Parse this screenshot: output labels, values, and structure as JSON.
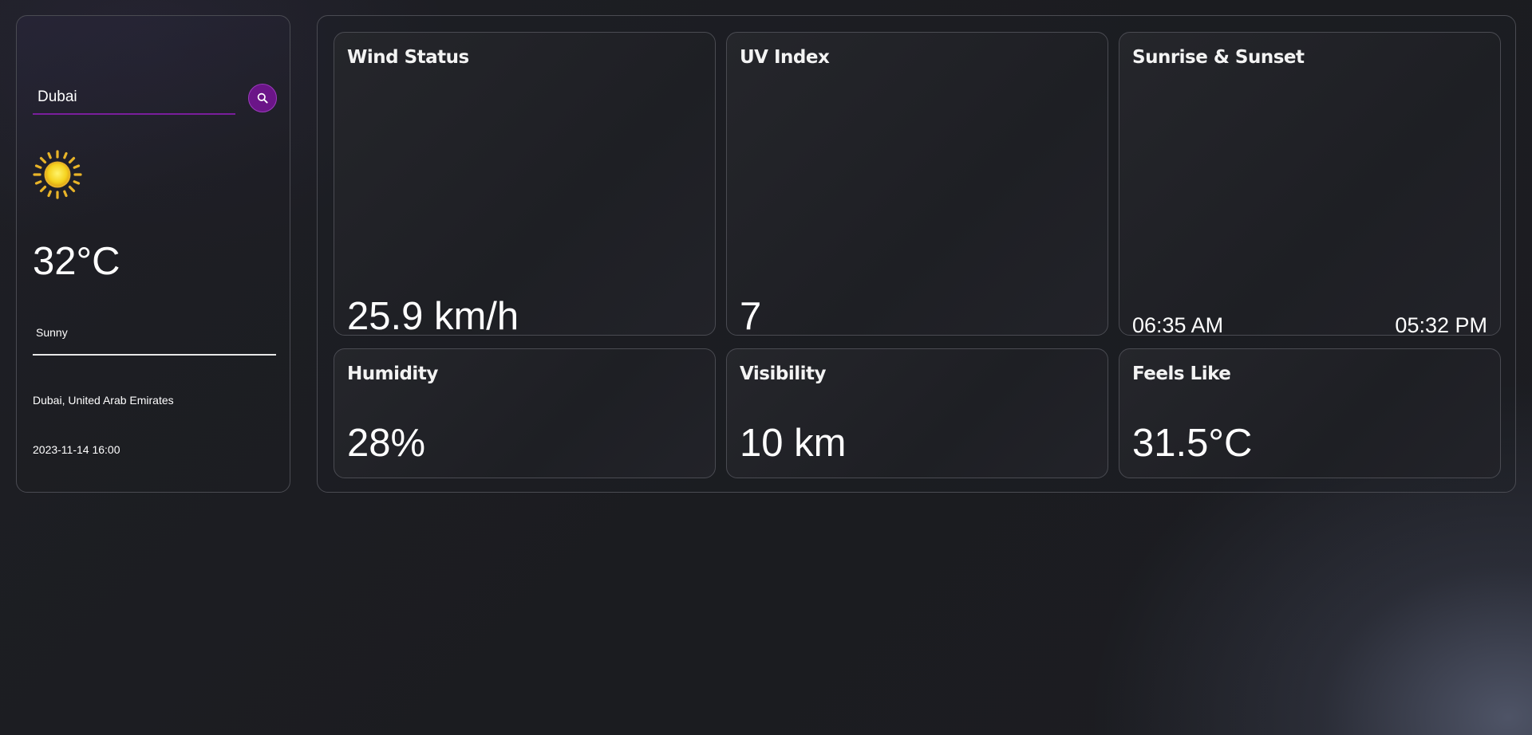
{
  "sidebar": {
    "search": {
      "value": "Dubai",
      "placeholder": ""
    },
    "search_icon": "search-icon",
    "weather_icon": "sun-icon",
    "temperature": "32°C",
    "condition": "Sunny",
    "location": "Dubai, United Arab Emirates",
    "datetime": "2023-11-14 16:00"
  },
  "highlights": {
    "wind": {
      "title": "Wind Status",
      "value": "25.9 km/h"
    },
    "uv": {
      "title": "UV Index",
      "value": "7"
    },
    "sun": {
      "title": "Sunrise & Sunset",
      "sunrise": "06:35 AM",
      "sunset": "05:32 PM"
    },
    "humidity": {
      "title": "Humidity",
      "value": "28%"
    },
    "visibility": {
      "title": "Visibility",
      "value": "10 km"
    },
    "feels_like": {
      "title": "Feels Like",
      "value": "31.5°C"
    }
  },
  "colors": {
    "accent": "#6b1588",
    "search_underline": "#7a1e9c",
    "card_border": "#4a4b52",
    "background": "#1c1d21",
    "sun_yellow": "#f5d21f"
  }
}
